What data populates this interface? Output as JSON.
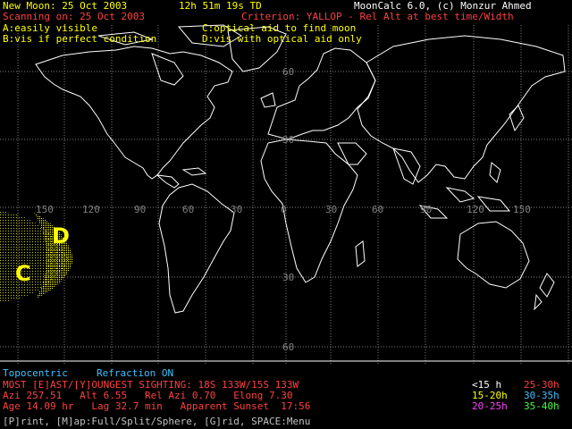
{
  "header": {
    "new_moon": "New Moon: 25 Oct 2003",
    "time": "12h 51m 19s TD",
    "app": "MoonCalc 6.0, (c) Monzur Ahmed",
    "scanning": "Scanning on: 25 Oct 2003",
    "criterion": "Criterion: YALLOP - Rel Alt at best time/Width"
  },
  "legend_codes": {
    "a": "A:easily visible",
    "c": "C:optical aid to find moon",
    "b": "B:vis if perfect condition",
    "d": "D:vis with optical aid only"
  },
  "map": {
    "lon_labels": [
      "150",
      "120",
      "90",
      "60",
      "30",
      "0",
      "30",
      "60",
      "90",
      "120",
      "150"
    ],
    "lat_labels": [
      "60",
      "30",
      "30",
      "60"
    ],
    "zone_labels": [
      "D",
      "C"
    ],
    "colors": {
      "coast": "#ffffff",
      "grid": "#808080",
      "zone": "#ffff00"
    }
  },
  "status": {
    "mode": "Topocentric",
    "refraction": "Refraction ON",
    "sighting": "MOST [E]AST/[Y]OUNGEST SIGHTING: 18S 133W/15S 133W",
    "line1": "Azi 257.51   Alt 6.55   Rel Azi 0.70   Elong 7.30",
    "line2": "Age 14.09 hr   Lag 32.7 min   Apparent Sunset  17:56"
  },
  "duration_legend": [
    {
      "label": "<15 h",
      "color": "#ffffff"
    },
    {
      "label": "25-30h",
      "color": "#ff4040"
    },
    {
      "label": "15-20h",
      "color": "#ffff00"
    },
    {
      "label": "30-35h",
      "color": "#40c0ff"
    },
    {
      "label": "20-25h",
      "color": "#ff40ff"
    },
    {
      "label": "35-40h",
      "color": "#40ff40"
    }
  ],
  "menu": "[P]rint, [M]ap:Full/Split/Sphere, [G]rid, SPACE:Menu"
}
